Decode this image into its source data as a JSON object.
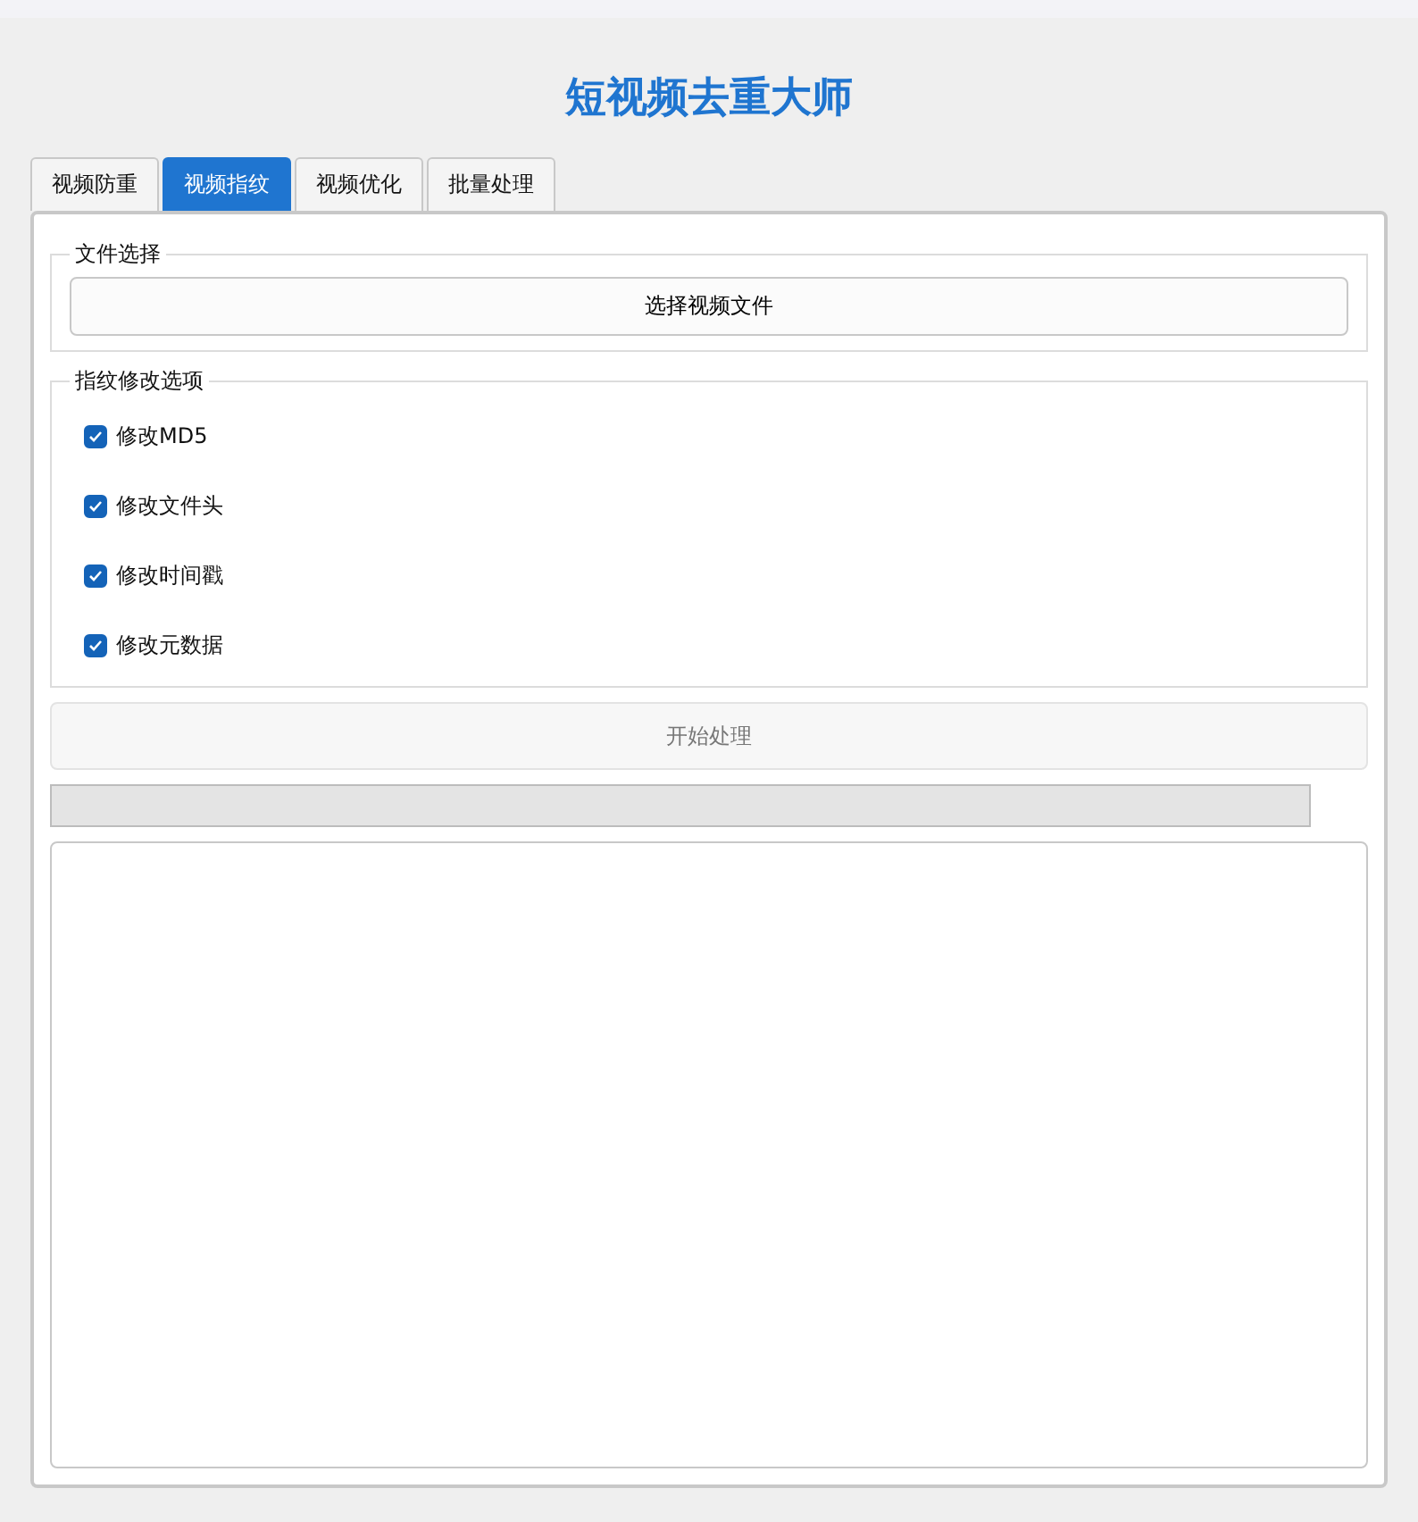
{
  "title": "短视频去重大师",
  "tabs": [
    {
      "label": "视频防重",
      "selected": false
    },
    {
      "label": "视频指纹",
      "selected": true
    },
    {
      "label": "视频优化",
      "selected": false
    },
    {
      "label": "批量处理",
      "selected": false
    }
  ],
  "file_group": {
    "title": "文件选择",
    "button": "选择视频文件"
  },
  "options_group": {
    "title": "指纹修改选项",
    "options": [
      {
        "label": "修改MD5",
        "checked": true
      },
      {
        "label": "修改文件头",
        "checked": true
      },
      {
        "label": "修改时间戳",
        "checked": true
      },
      {
        "label": "修改元数据",
        "checked": true
      }
    ]
  },
  "start_button": {
    "label": "开始处理",
    "disabled": true
  },
  "progress": {
    "level": 0
  }
}
